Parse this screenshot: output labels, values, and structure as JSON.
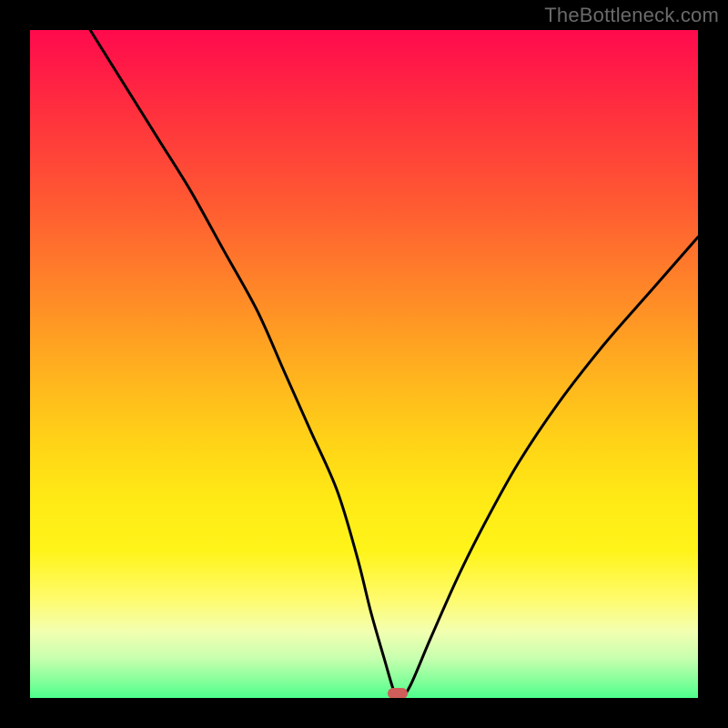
{
  "watermark": {
    "text": "TheBottleneck.com"
  },
  "colors": {
    "background": "#000000",
    "curve_stroke": "#000000",
    "marker_fill": "#cf5d59",
    "gradient_top": "#ff0a4d",
    "gradient_bottom": "#4dff8d"
  },
  "chart_data": {
    "type": "line",
    "title": "",
    "xlabel": "",
    "ylabel": "",
    "xlim": [
      0,
      100
    ],
    "ylim": [
      0,
      100
    ],
    "grid": false,
    "legend": false,
    "series": [
      {
        "name": "bottleneck-curve",
        "x": [
          9,
          14,
          19,
          24,
          29,
          34,
          38,
          42,
          46,
          49,
          51,
          53,
          54.5,
          55.5,
          57,
          60,
          64,
          68,
          73,
          79,
          86,
          93,
          100
        ],
        "y": [
          100,
          92,
          84,
          76,
          67,
          58,
          49,
          40,
          31,
          21,
          13,
          6,
          1,
          0,
          2,
          9,
          18,
          26,
          35,
          44,
          53,
          61,
          69
        ]
      }
    ],
    "marker": {
      "x": 55,
      "y": 0.7,
      "shape": "pill"
    },
    "annotations": []
  }
}
